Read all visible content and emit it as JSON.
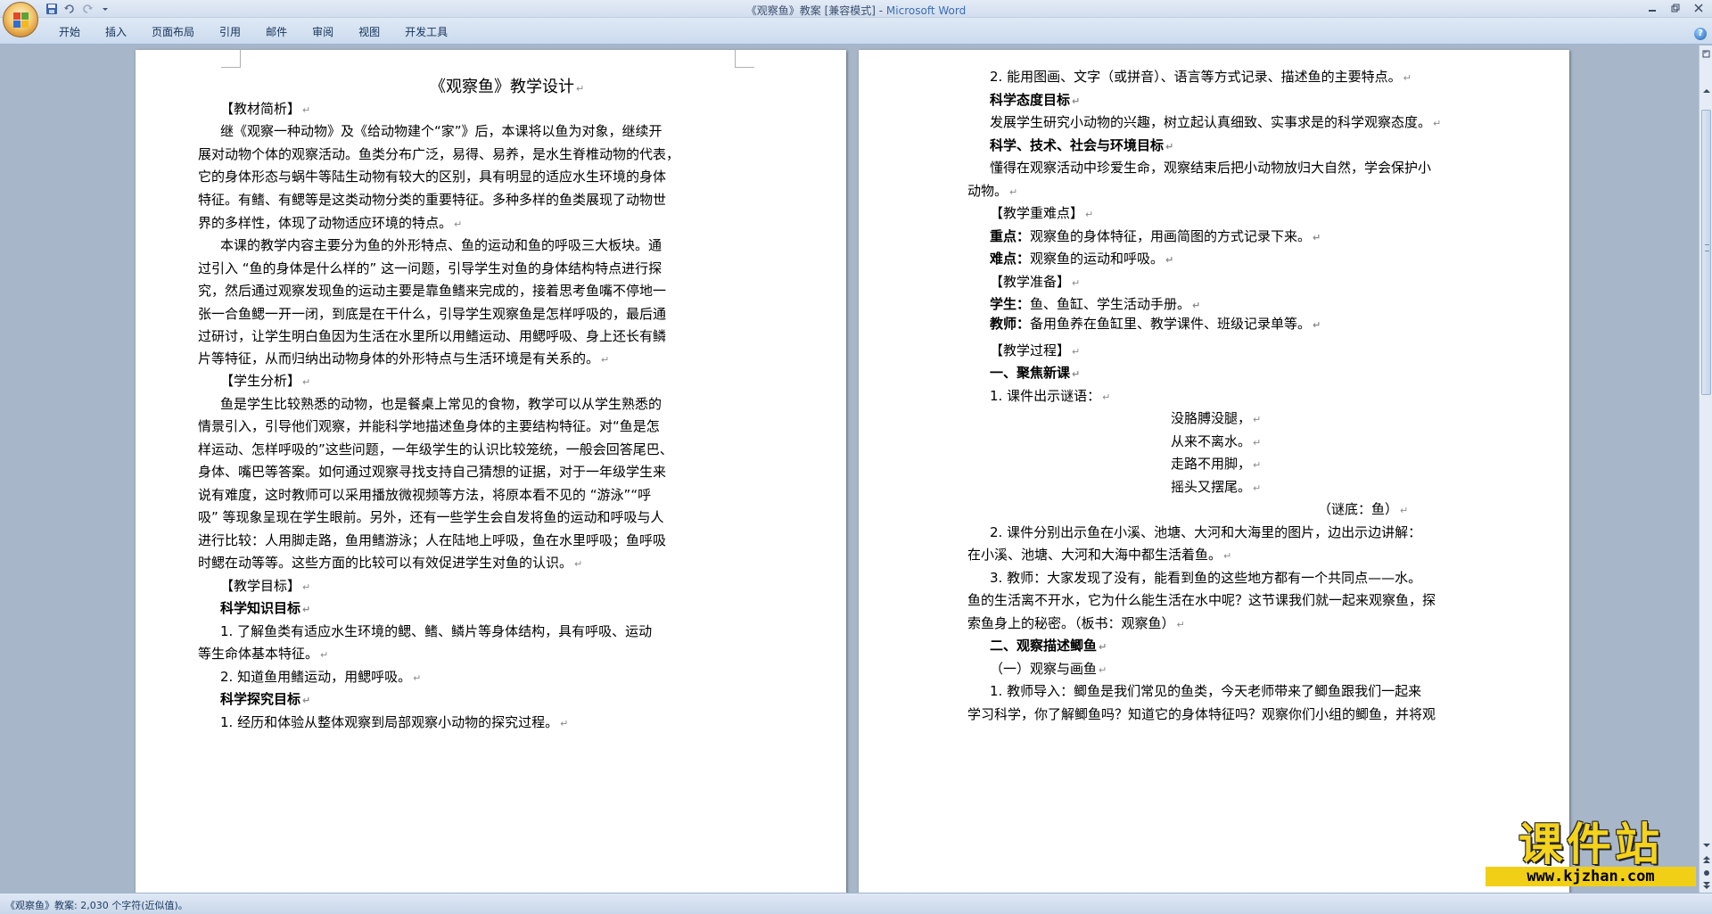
{
  "window": {
    "title_doc": "《观察鱼》教案 [兼容模式] - ",
    "title_app": "Microsoft Word",
    "minimize_icon": "minimize-icon",
    "restore_icon": "restore-icon",
    "close_icon": "close-icon"
  },
  "qat": {
    "save_icon": "save-icon",
    "undo_icon": "undo-icon",
    "redo_icon": "redo-icon",
    "customize_icon": "dropdown-icon"
  },
  "ribbon": {
    "tabs": [
      "开始",
      "插入",
      "页面布局",
      "引用",
      "邮件",
      "审阅",
      "视图",
      "开发工具"
    ],
    "help": "?"
  },
  "paragraph_mark": "↵",
  "page1": {
    "title": "《观察鱼》教学设计",
    "lines": [
      "【教材简析】",
      "继《观察一种动物》及《给动物建个“家”》后，本课将以鱼为对象，继续开",
      "展对动物个体的观察活动。鱼类分布广泛，易得、易养，是水生脊椎动物的代表，",
      "它的身体形态与蜗牛等陆生动物有较大的区别，具有明显的适应水生环境的身体",
      "特征。有鳍、有鳃等是这类动物分类的重要特征。多种多样的鱼类展现了动物世",
      "界的多样性，体现了动物适应环境的特点。",
      "本课的教学内容主要分为鱼的外形特点、鱼的运动和鱼的呼吸三大板块。通",
      "过引入 “鱼的身体是什么样的” 这一问题，引导学生对鱼的身体结构特点进行探",
      "究，然后通过观察发现鱼的运动主要是靠鱼鳍来完成的，接着思考鱼嘴不停地一",
      "张一合鱼鳃一开一闭，到底是在干什么，引导学生观察鱼是怎样呼吸的，最后通",
      "过研讨，让学生明白鱼因为生活在水里所以用鳍运动、用鳃呼吸、身上还长有鳞",
      "片等特征，从而归纳出动物身体的外形特点与生活环境是有关系的。",
      "【学生分析】",
      "鱼是学生比较熟悉的动物，也是餐桌上常见的食物，教学可以从学生熟悉的",
      "情景引入，引导他们观察，并能科学地描述鱼身体的主要结构特征。对“鱼是怎",
      "样运动、怎样呼吸的”这些问题，一年级学生的认识比较笼统，一般会回答尾巴、",
      "身体、嘴巴等答案。如何通过观察寻找支持自己猜想的证据，对于一年级学生来",
      "说有难度，这时教师可以采用播放微视频等方法，将原本看不见的 “游泳”“呼",
      "吸” 等现象呈现在学生眼前。另外，还有一些学生会自发将鱼的运动和呼吸与人",
      "进行比较：人用脚走路，鱼用鳍游泳；人在陆地上呼吸，鱼在水里呼吸；鱼呼吸",
      "时鳃在动等等。这些方面的比较可以有效促进学生对鱼的认识。",
      "【教学目标】",
      "科学知识目标",
      "1. 了解鱼类有适应水生环境的鳃、鳍、鳞片等身体结构，具有呼吸、运动",
      "等生命体基本特征。",
      "2. 知道鱼用鳍运动，用鳃呼吸。",
      "科学探究目标",
      "1. 经历和体验从整体观察到局部观察小动物的探究过程。"
    ]
  },
  "page2": {
    "lines": [
      "2. 能用图画、文字（或拼音）、语言等方式记录、描述鱼的主要特点。",
      "科学态度目标",
      "发展学生研究小动物的兴趣，树立起认真细致、实事求是的科学观察态度。",
      "科学、技术、社会与环境目标",
      "懂得在观察活动中珍爱生命，观察结束后把小动物放归大自然，学会保护小",
      "动物。",
      "【教学重难点】",
      "重点：",
      "观察鱼的身体特征，用画简图的方式记录下来。",
      "难点：",
      "观察鱼的运动和呼吸。",
      "【教学准备】",
      "学生：",
      "鱼、鱼缸、学生活动手册。",
      "教师：",
      "备用鱼养在鱼缸里、教学课件、班级记录单等。",
      "【教学过程】",
      "一、聚焦新课",
      "1. 课件出示谜语：",
      "没胳膊没腿，",
      "从来不离水。",
      "走路不用脚，",
      "摇头又摆尾。",
      "（谜底：鱼）",
      "2. 课件分别出示鱼在小溪、池塘、大河和大海里的图片，边出示边讲解：",
      "在小溪、池塘、大河和大海中都生活着鱼。",
      "3. 教师：大家发现了没有，能看到鱼的这些地方都有一个共同点——水。",
      "鱼的生活离不开水，它为什么能生活在水中呢？这节课我们就一起来观察鱼，探",
      "索鱼身上的秘密。（板书：观察鱼）",
      "二、观察描述鲫鱼",
      "（一）观察与画鱼",
      "1. 教师导入：鲫鱼是我们常见的鱼类，今天老师带来了鲫鱼跟我们一起来",
      "学习科学，你了解鲫鱼吗？知道它的身体特征吗？观察你们小组的鲫鱼，并将观"
    ]
  },
  "status": {
    "text": "《观察鱼》教案: 2,030 个字符(近似值)。"
  },
  "scrollbar": {
    "up_icon": "scroll-up-icon",
    "down_icon": "scroll-down-icon",
    "prev_page_icon": "prev-page-icon",
    "next_page_icon": "next-page-icon"
  },
  "watermark": {
    "cn": "课件站",
    "url": "www.kjzhan.com"
  }
}
